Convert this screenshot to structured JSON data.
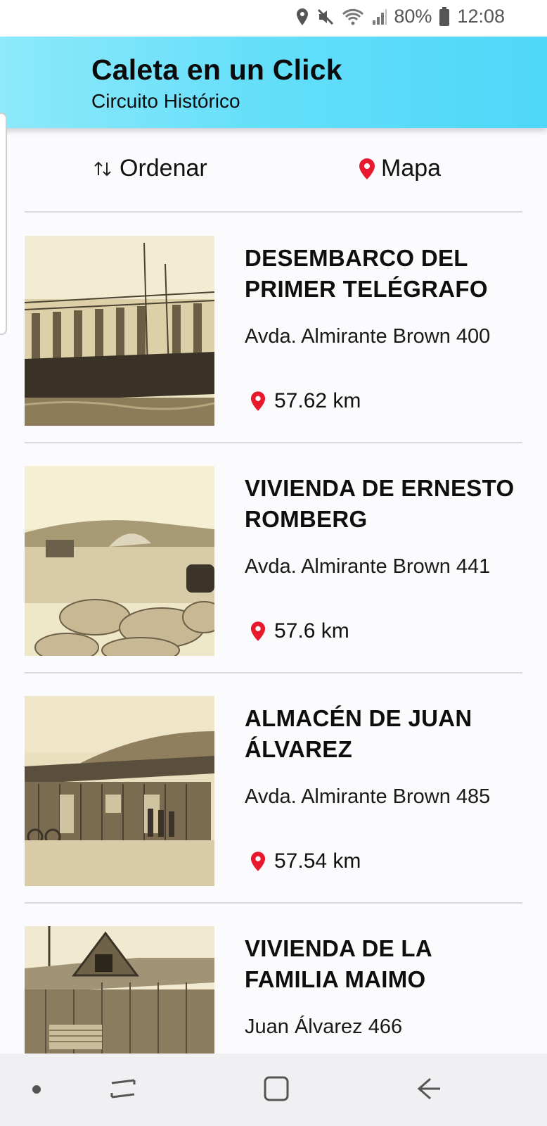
{
  "status_bar": {
    "battery": "80%",
    "time": "12:08"
  },
  "app_bar": {
    "title": "Caleta en un Click",
    "subtitle": "Circuito Histórico"
  },
  "toolbar": {
    "sort_label": "Ordenar",
    "map_label": "Mapa"
  },
  "colors": {
    "accent_pin": "#e8192c",
    "app_bar_start": "#8ee9fb",
    "app_bar_end": "#4fd7f9"
  },
  "items": [
    {
      "title": "DESEMBARCO DEL PRIMER TELÉGRAFO",
      "address": "Avda. Almirante Brown 400",
      "distance": "57.62 km"
    },
    {
      "title": "VIVIENDA DE ERNESTO ROMBERG",
      "address": "Avda. Almirante Brown 441",
      "distance": "57.6 km"
    },
    {
      "title": "ALMACÉN DE JUAN ÁLVAREZ",
      "address": "Avda. Almirante Brown 485",
      "distance": "57.54 km"
    },
    {
      "title": "VIVIENDA DE LA FAMILIA MAIMO",
      "address": "Juan Álvarez 466",
      "distance": ""
    }
  ]
}
